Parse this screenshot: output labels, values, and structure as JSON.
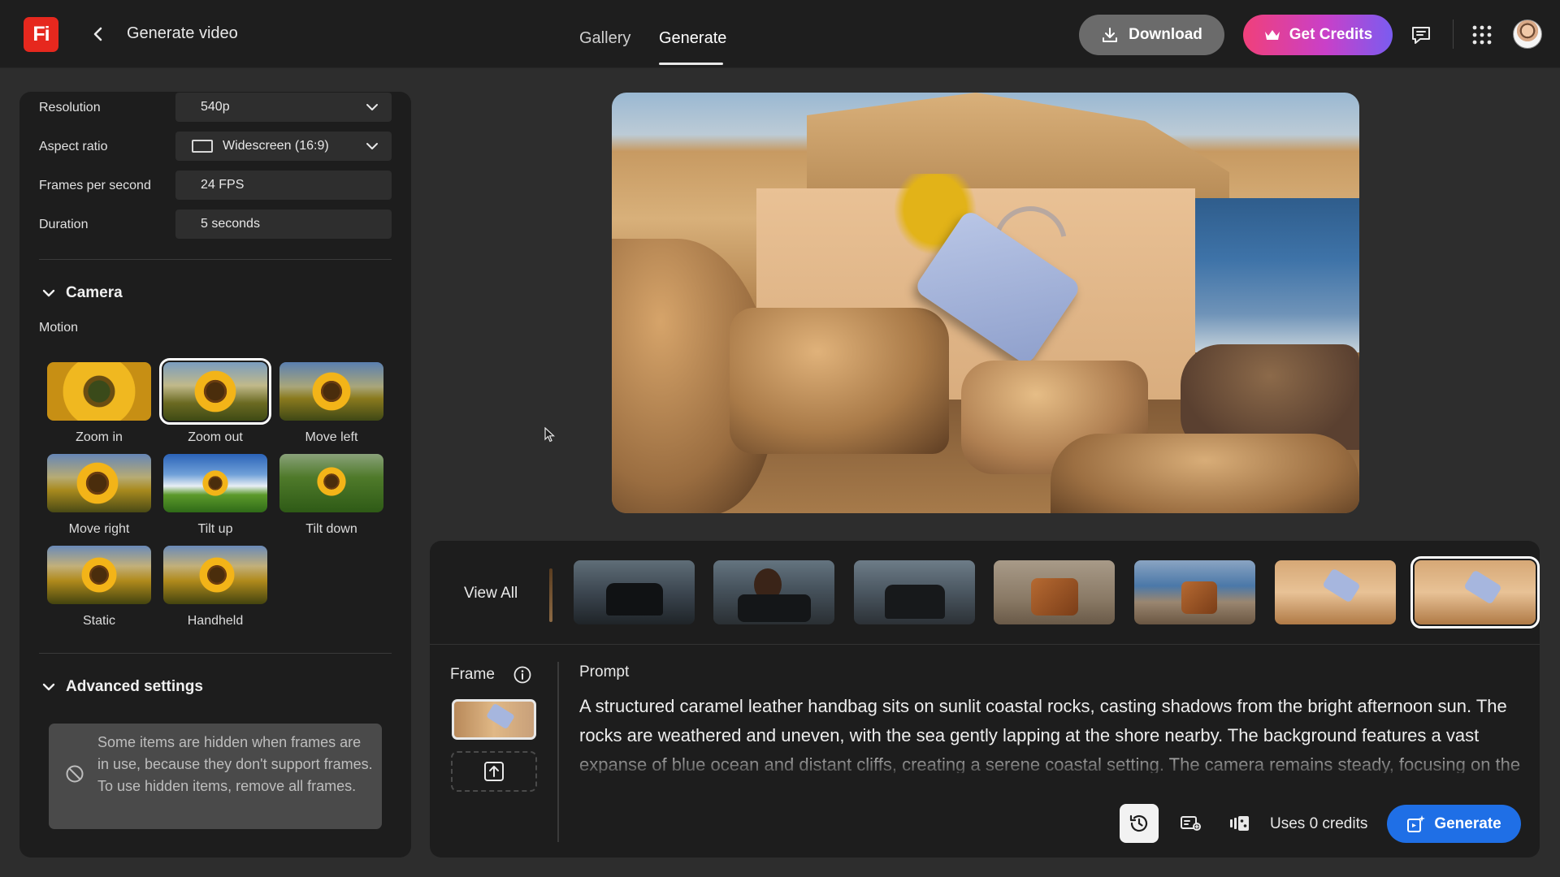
{
  "header": {
    "logo_text": "Fi",
    "page_title": "Generate video",
    "tabs": [
      {
        "label": "Gallery",
        "active": false
      },
      {
        "label": "Generate",
        "active": true
      }
    ],
    "download_label": "Download",
    "credits_label": "Get Credits",
    "icons": [
      "back-chevron-icon",
      "download-icon",
      "crown-icon",
      "feedback-icon",
      "app-grid-icon",
      "avatar"
    ]
  },
  "settings": {
    "resolution": {
      "label": "Resolution",
      "value": "540p"
    },
    "aspect_ratio": {
      "label": "Aspect ratio",
      "value": "Widescreen (16:9)"
    },
    "fps": {
      "label": "Frames per second",
      "value": "24 FPS"
    },
    "duration": {
      "label": "Duration",
      "value": "5 seconds"
    }
  },
  "camera": {
    "section_title": "Camera",
    "motion_label": "Motion",
    "motions": [
      {
        "label": "Zoom in",
        "selected": false
      },
      {
        "label": "Zoom out",
        "selected": true
      },
      {
        "label": "Move left",
        "selected": false
      },
      {
        "label": "Move right",
        "selected": false
      },
      {
        "label": "Tilt up",
        "selected": false
      },
      {
        "label": "Tilt down",
        "selected": false
      },
      {
        "label": "Static",
        "selected": false
      },
      {
        "label": "Handheld",
        "selected": false
      }
    ]
  },
  "advanced": {
    "section_title": "Advanced settings",
    "tooltip": "Some items are hidden when frames are in use, because they don't support frames. To use hidden items, remove all frames."
  },
  "history": {
    "view_all_label": "View All",
    "thumbnail_count": 7,
    "selected_index": 6
  },
  "frame": {
    "label": "Frame"
  },
  "prompt": {
    "label": "Prompt",
    "text": "A structured caramel leather handbag sits on sunlit coastal rocks, casting shadows from the bright afternoon sun. The rocks are weathered and uneven, with the sea gently lapping at the shore nearby. The background features a vast expanse of blue ocean and distant cliffs, creating a serene coastal setting. The camera remains steady, focusing on the"
  },
  "footer": {
    "credits_text": "Uses 0 credits",
    "generate_label": "Generate"
  },
  "colors": {
    "accent_blue": "#1f6fe6",
    "credits_gradient_start": "#f0407a",
    "credits_gradient_end": "#7a5cf0",
    "logo_red": "#e6281e"
  }
}
